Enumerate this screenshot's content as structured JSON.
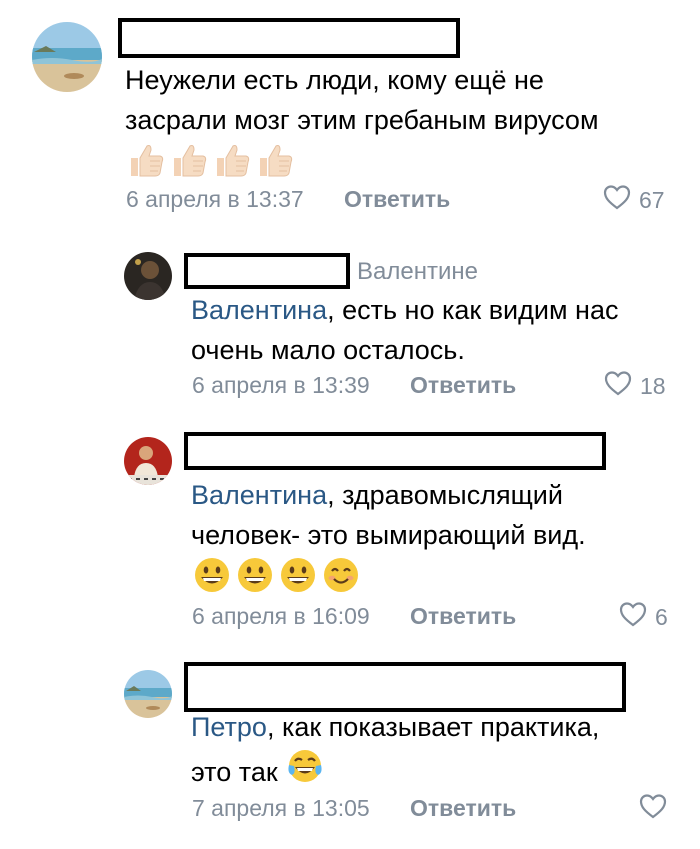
{
  "comments": [
    {
      "text": "Неужели есть люди, кому ещё не засрали мозг этим гребаным вирусом",
      "line1": "Неужели есть люди, кому ещё не",
      "line2": "засрали мозг этим гребаным вирусом",
      "emojis": [
        "thumbs-up",
        "thumbs-up",
        "thumbs-up",
        "thumbs-up"
      ],
      "date": "6 апреля в 13:37",
      "reply_label": "Ответить",
      "likes": "67"
    },
    {
      "reply_to": "Валентине",
      "mention": "Валентина",
      "line1_rest": ", есть но как видим нас",
      "line2": "очень мало осталось.",
      "date": "6 апреля в 13:39",
      "reply_label": "Ответить",
      "likes": "18"
    },
    {
      "mention": "Валентина",
      "line1_rest": ", здравомыслящий",
      "line2": "человек- это вымирающий вид.",
      "emojis": [
        "grinning",
        "grinning",
        "grinning",
        "smiling"
      ],
      "date": "6 апреля в 16:09",
      "reply_label": "Ответить",
      "likes": "6"
    },
    {
      "mention": "Петро",
      "line1_rest": ", как показывает практика,",
      "line2": "это так",
      "emojis": [
        "tears-of-joy"
      ],
      "date": "7 апреля в 13:05",
      "reply_label": "Ответить",
      "likes": ""
    }
  ],
  "colors": {
    "meta": "#818c99",
    "mention": "#2a5885",
    "text": "#000000"
  }
}
